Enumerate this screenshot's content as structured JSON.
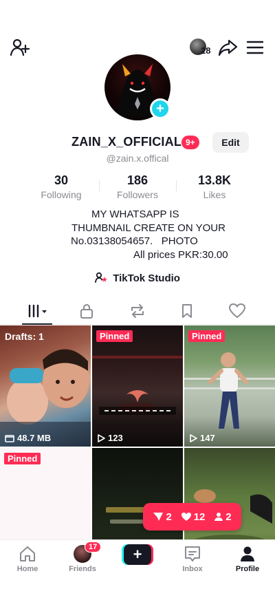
{
  "topbar": {
    "story_count": "28"
  },
  "profile": {
    "username": "ZAIN_X_OFFICIAL",
    "notif_badge": "9+",
    "edit_label": "Edit",
    "handle": "@zain.x.offical"
  },
  "stats": [
    {
      "value": "30",
      "label": "Following"
    },
    {
      "value": "186",
      "label": "Followers"
    },
    {
      "value": "13.8K",
      "label": "Likes"
    }
  ],
  "bio": {
    "line1": "MY WHATSAPP IS",
    "line2": "THUMBNAIL CREATE ON YOUR",
    "line3": "No.03138054657.   PHOTO",
    "line4": "All prices PKR:30.00"
  },
  "studio": {
    "label": "TikTok Studio"
  },
  "grid": {
    "drafts_label": "Drafts: 1",
    "drafts_size": "48.7 MB",
    "pinned_label": "Pinned",
    "views_2": "123",
    "views_3": "147"
  },
  "live_pill": {
    "shares": "2",
    "likes": "12",
    "users": "2"
  },
  "bottom_nav": {
    "home": "Home",
    "friends": "Friends",
    "friends_badge": "17",
    "inbox": "Inbox",
    "profile": "Profile"
  },
  "colors": {
    "accent": "#fe2c55",
    "cyan": "#25f4ee",
    "text": "#161823",
    "muted": "#8a8b91"
  }
}
